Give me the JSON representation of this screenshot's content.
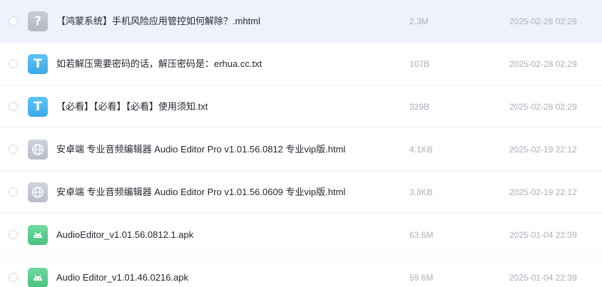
{
  "files": [
    {
      "name": "【鸿蒙系统】手机风险应用管控如何解除？.mhtml",
      "size": "2.3M",
      "date": "2025-02-28 02:29",
      "icon": "unknown-file-icon",
      "selected": true
    },
    {
      "name": "如若解压需要密码的话，解压密码是：erhua.cc.txt",
      "size": "107B",
      "date": "2025-02-28 02:29",
      "icon": "text-file-icon",
      "selected": false
    },
    {
      "name": "【必看】【必看】【必看】使用须知.txt",
      "size": "329B",
      "date": "2025-02-28 02:29",
      "icon": "text-file-icon",
      "selected": false
    },
    {
      "name": "安卓端 专业音频编辑器 Audio Editor Pro v1.01.56.0812 专业vip版.html",
      "size": "4.1KB",
      "date": "2025-02-19 22:12",
      "icon": "html-file-icon",
      "selected": false
    },
    {
      "name": "安卓端 专业音频编辑器 Audio Editor Pro v1.01.56.0609 专业vip版.html",
      "size": "3.8KB",
      "date": "2025-02-19 22:12",
      "icon": "html-file-icon",
      "selected": false
    },
    {
      "name": "AudioEditor_v1.01.56.0812.1.apk",
      "size": "63.6M",
      "date": "2025-01-04 22:39",
      "icon": "apk-file-icon",
      "selected": false
    },
    {
      "name": "Audio Editor_v1.01.46.0216.apk",
      "size": "59.6M",
      "date": "2025-01-04 22:39",
      "icon": "apk-file-icon",
      "selected": false
    }
  ],
  "icons": {
    "unknown_glyph": "?",
    "text_glyph": "T"
  },
  "colors": {
    "selected_row_bg": "#eef2fc",
    "text_icon": "#3aa9e8",
    "apk_icon": "#49c27e",
    "unknown_icon": "#b4b8c4",
    "meta_text": "#a9afba"
  }
}
